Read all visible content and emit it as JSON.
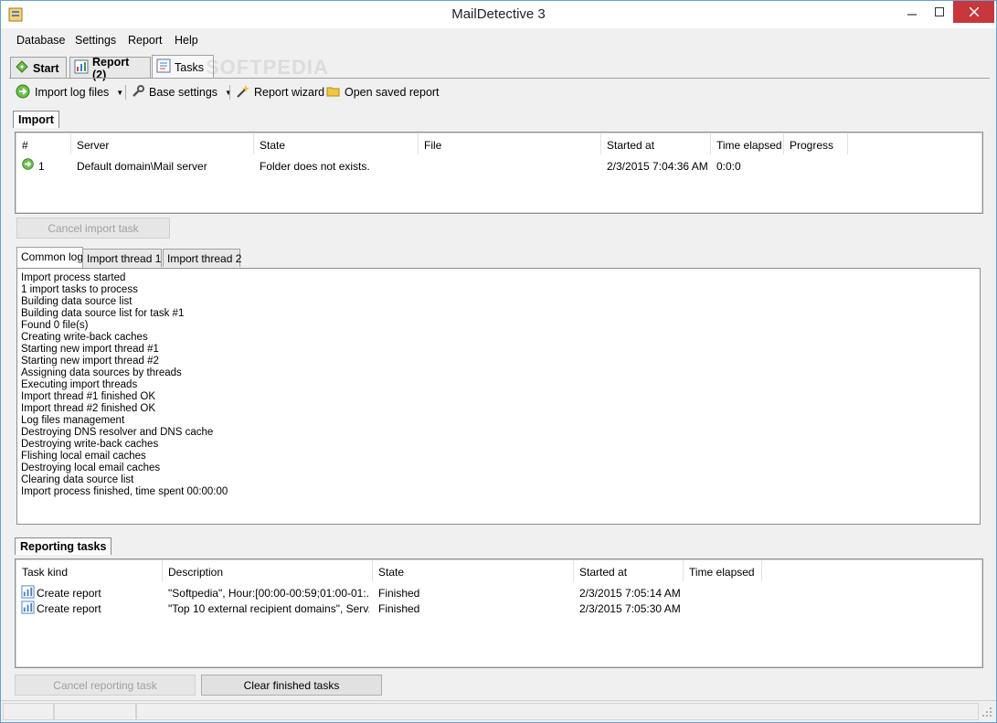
{
  "window": {
    "title": "MailDetective 3"
  },
  "menu": [
    "Database",
    "Settings",
    "Report",
    "Help"
  ],
  "main_tabs": [
    {
      "label": "Start",
      "icon": "start-icon"
    },
    {
      "label": "Report (2)",
      "icon": "report-icon"
    },
    {
      "label": "Tasks",
      "icon": "tasks-icon"
    }
  ],
  "watermark": "SOFTPEDIA",
  "toolbar": {
    "import_log_files": "Import log files",
    "base_settings": "Base settings",
    "report_wizard": "Report wizard",
    "open_saved_report": "Open saved report"
  },
  "import_section": {
    "title": "Import",
    "columns": [
      "#",
      "Server",
      "State",
      "File",
      "Started at",
      "Time elapsed",
      "Progress"
    ],
    "rows": [
      {
        "num": "1",
        "server": "Default domain\\Mail server",
        "state": "Folder  does not exists.",
        "file": "",
        "started": "2/3/2015 7:04:36 AM",
        "elapsed": "0:0:0",
        "progress": ""
      }
    ],
    "cancel_button": "Cancel import task"
  },
  "log_tabs": [
    "Common log",
    "Import thread 1",
    "Import thread 2"
  ],
  "log_lines": [
    "Import process started",
    "1 import tasks to process",
    "Building data source list",
    "Building data source list for task #1",
    "Found 0 file(s)",
    "Creating write-back caches",
    "Starting new import thread #1",
    "Starting new import thread #2",
    "Assigning data sources by threads",
    "Executing import threads",
    "Import thread #1 finished OK",
    "Import thread #2 finished OK",
    "Log files management",
    "Destroying DNS resolver and DNS cache",
    "Destroying write-back caches",
    "Flishing local email caches",
    "Destroying local email caches",
    "Clearing data source list",
    "Import process finished, time spent 00:00:00"
  ],
  "reporting_section": {
    "title": "Reporting tasks",
    "columns": [
      "Task kind",
      "Description",
      "State",
      "Started at",
      "Time elapsed"
    ],
    "rows": [
      {
        "kind": "Create report",
        "description": "\"Softpedia\", Hour:[00:00-00:59;01:00-01:...",
        "state": "Finished",
        "started": "2/3/2015 7:05:14 AM",
        "elapsed": ""
      },
      {
        "kind": "Create report",
        "description": "\"Top 10 external recipient domains\", Serv...",
        "state": "Finished",
        "started": "2/3/2015 7:05:30 AM",
        "elapsed": ""
      }
    ],
    "cancel_button": "Cancel reporting task",
    "clear_button": "Clear finished tasks"
  }
}
